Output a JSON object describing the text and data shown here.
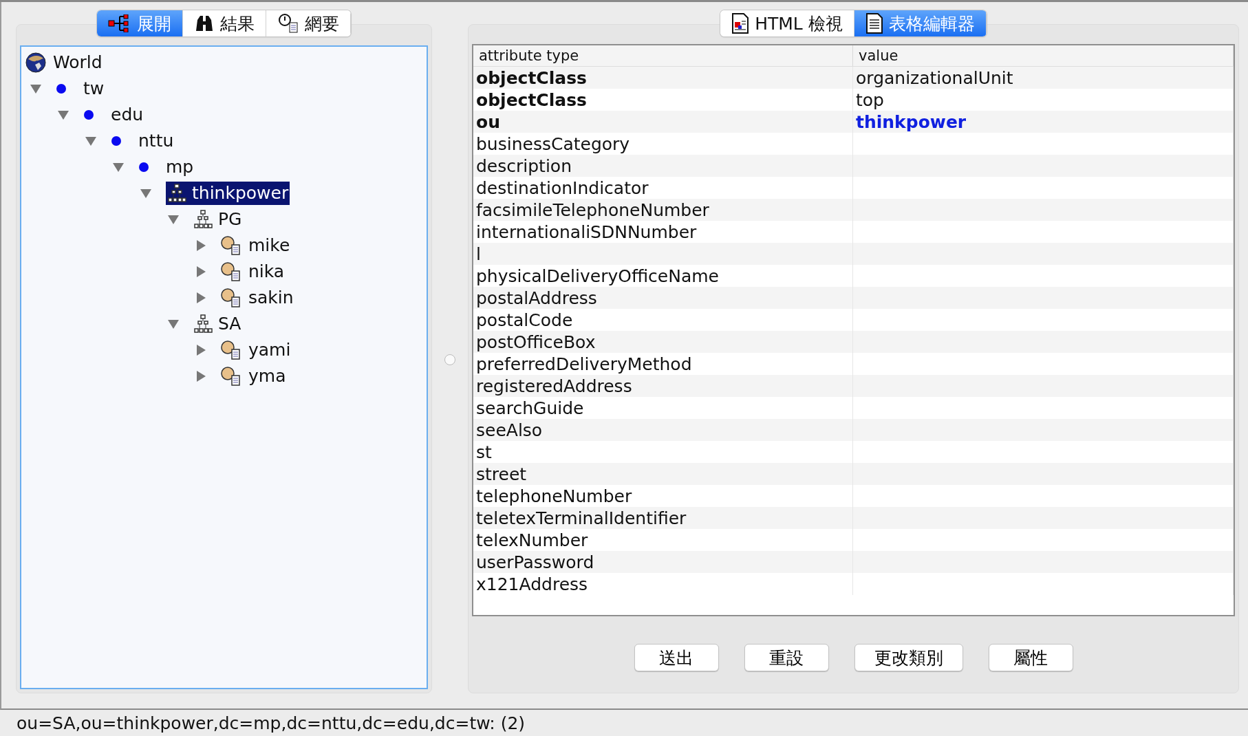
{
  "left_tabs": [
    {
      "label": "展開",
      "kind": "expand",
      "selected": true
    },
    {
      "label": "結果",
      "kind": "search",
      "selected": false
    },
    {
      "label": "網要",
      "kind": "schema",
      "selected": false
    }
  ],
  "tree": {
    "root": {
      "label": "World"
    },
    "items": [
      {
        "label": "tw",
        "kind": "dc",
        "expanded": true,
        "selected": false,
        "children": [
          {
            "label": "edu",
            "kind": "dc",
            "expanded": true,
            "selected": false,
            "children": [
              {
                "label": "nttu",
                "kind": "dc",
                "expanded": true,
                "selected": false,
                "children": [
                  {
                    "label": "mp",
                    "kind": "dc",
                    "expanded": true,
                    "selected": false,
                    "children": [
                      {
                        "label": "thinkpower",
                        "kind": "ou",
                        "expanded": true,
                        "selected": true,
                        "children": [
                          {
                            "label": "PG",
                            "kind": "ou",
                            "expanded": true,
                            "selected": false,
                            "children": [
                              {
                                "label": "mike",
                                "kind": "person",
                                "expanded": false,
                                "selected": false
                              },
                              {
                                "label": "nika",
                                "kind": "person",
                                "expanded": false,
                                "selected": false
                              },
                              {
                                "label": "sakin",
                                "kind": "person",
                                "expanded": false,
                                "selected": false
                              }
                            ]
                          },
                          {
                            "label": "SA",
                            "kind": "ou",
                            "expanded": true,
                            "selected": false,
                            "children": [
                              {
                                "label": "yami",
                                "kind": "person",
                                "expanded": false,
                                "selected": false
                              },
                              {
                                "label": "yma",
                                "kind": "person",
                                "expanded": false,
                                "selected": false
                              }
                            ]
                          }
                        ]
                      }
                    ]
                  }
                ]
              }
            ]
          }
        ]
      }
    ]
  },
  "right_tabs": [
    {
      "label": "HTML 檢視",
      "kind": "html",
      "selected": false
    },
    {
      "label": "表格編輯器",
      "kind": "table",
      "selected": true
    }
  ],
  "table": {
    "columns": [
      "attribute type",
      "value"
    ],
    "rows": [
      {
        "attribute": "objectClass",
        "value": "organizationalUnit",
        "required": true,
        "naming": false
      },
      {
        "attribute": "objectClass",
        "value": "top",
        "required": true,
        "naming": false
      },
      {
        "attribute": "ou",
        "value": "thinkpower",
        "required": true,
        "naming": true
      },
      {
        "attribute": "businessCategory",
        "required": false
      },
      {
        "attribute": "description",
        "required": false
      },
      {
        "attribute": "destinationIndicator",
        "required": false
      },
      {
        "attribute": "facsimileTelephoneNumber",
        "required": false
      },
      {
        "attribute": "internationaliSDNNumber",
        "required": false
      },
      {
        "attribute": "l",
        "required": false
      },
      {
        "attribute": "physicalDeliveryOfficeName",
        "required": false
      },
      {
        "attribute": "postalAddress",
        "required": false
      },
      {
        "attribute": "postalCode",
        "required": false
      },
      {
        "attribute": "postOfficeBox",
        "required": false
      },
      {
        "attribute": "preferredDeliveryMethod",
        "required": false
      },
      {
        "attribute": "registeredAddress",
        "required": false
      },
      {
        "attribute": "searchGuide",
        "required": false
      },
      {
        "attribute": "seeAlso",
        "required": false
      },
      {
        "attribute": "st",
        "required": false
      },
      {
        "attribute": "street",
        "required": false
      },
      {
        "attribute": "telephoneNumber",
        "required": false
      },
      {
        "attribute": "teletexTerminalIdentifier",
        "required": false
      },
      {
        "attribute": "telexNumber",
        "required": false
      },
      {
        "attribute": "userPassword",
        "required": false
      },
      {
        "attribute": "x121Address",
        "required": false
      }
    ]
  },
  "buttons": [
    "送出",
    "重設",
    "更改類別",
    "屬性"
  ],
  "status_bar": "ou=SA,ou=thinkpower,dc=mp,dc=nttu,dc=edu,dc=tw: (2)"
}
